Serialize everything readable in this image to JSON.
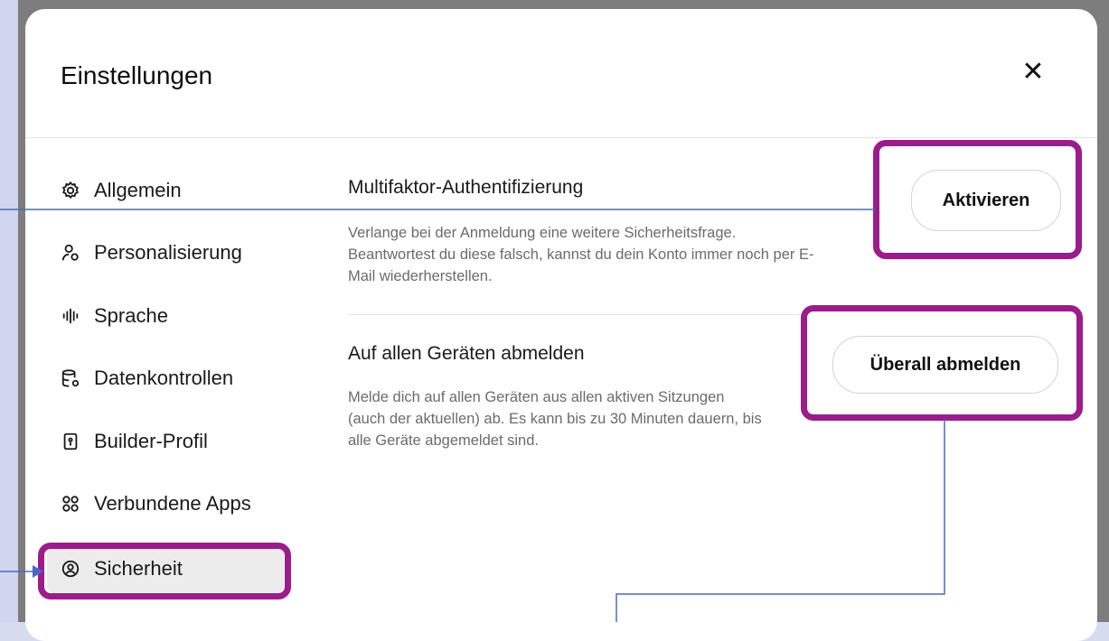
{
  "dialog": {
    "title": "Einstellungen",
    "close_glyph": "✕"
  },
  "sidebar": {
    "items": [
      {
        "label": "Allgemein",
        "icon": "gear-icon"
      },
      {
        "label": "Personalisierung",
        "icon": "person-icon"
      },
      {
        "label": "Sprache",
        "icon": "waveform-icon"
      },
      {
        "label": "Datenkontrollen",
        "icon": "database-icon"
      },
      {
        "label": "Builder-Profil",
        "icon": "id-card-icon"
      },
      {
        "label": "Verbundene Apps",
        "icon": "apps-icon"
      },
      {
        "label": "Sicherheit",
        "icon": "shield-user-icon",
        "active": true
      }
    ]
  },
  "security": {
    "mfa": {
      "title": "Multifaktor-Authentifizierung",
      "description": "Verlange bei der Anmeldung eine weitere Sicherheitsfrage. Beantwortest du diese falsch, kannst du dein Konto immer noch per E-Mail wiederherstellen.",
      "button": "Aktivieren"
    },
    "logout_all": {
      "title": "Auf allen Geräten abmelden",
      "description": "Melde dich auf allen Geräten aus allen aktiven Sitzungen (auch der aktuellen) ab. Es kann bis zu 30 Minuten dauern, bis alle Geräte abgemeldet sind.",
      "button": "Überall abmelden"
    }
  },
  "colors": {
    "highlight": "#9b1d8b",
    "connector": "#4a68c4"
  }
}
